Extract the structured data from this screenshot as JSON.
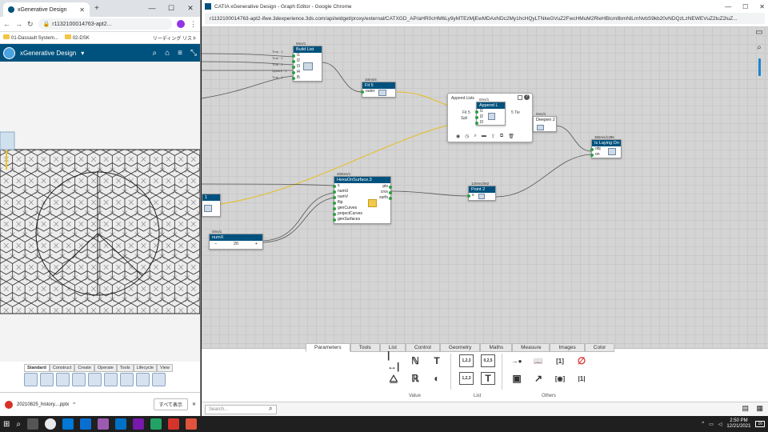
{
  "left_browser": {
    "tab_title": "xGenerative Design",
    "url": "r1132100014763-apt2...",
    "bookmarks": [
      "01-Dassault System...",
      "02-DSK",
      "リーディング リスト"
    ],
    "app_title": "xGenerative Design",
    "app_menu": "▾",
    "toolbar_tabs": [
      "Standard",
      "Construct",
      "Create",
      "Operate",
      "Tools",
      "Lifecycle",
      "View"
    ],
    "download_file": "20210825_history....pptx",
    "show_all": "すべて表示"
  },
  "right_browser": {
    "window_title": "CATIA xGenerative Design - Graph Editor - Google Chrome",
    "url": "r1132100014763-apt2-ifwe.3dexperience.3ds.com/api/widget/proxy/external/CATXGD_AP/aHR0cHM6Ly9yMTEzMjEwMDAxNDc2My1hcHQyLTNkeGVuZ2FwcHMuM2RleHBlcmllbmNlLmNvbS9kb20vNDQzLzNEWEVuZ2luZ2luZ..."
  },
  "nodes": {
    "build_list": {
      "status": "0ms/1",
      "title": "Build List",
      "ports": [
        "l1",
        "l2",
        "l3",
        "l4",
        "l5"
      ],
      "inputs": [
        "True - 1",
        "True - 1",
        "True - 1",
        "Sphere - 1",
        "True - 1"
      ]
    },
    "fit": {
      "status": "10ms/4",
      "title": "Fit 5",
      "ports": [
        "outer"
      ]
    },
    "append_lists": {
      "panel_label": "Append Lists",
      "status": "0ms/1",
      "title": "Append L",
      "ports_left": [
        "Fit 5",
        "Spli"
      ],
      "ports": [
        "l1",
        "l2",
        "l3"
      ],
      "out": "5 Tie"
    },
    "deepen": {
      "status": "0ms/1",
      "title": "Deepen 2"
    },
    "is_laying_on": {
      "status": "356ms/1396",
      "title": "Is Laying On",
      "ports": [
        "obj",
        "on"
      ]
    },
    "hexa": {
      "status": "206ms/1",
      "title": "HexaOnSurface.3",
      "ports": [
        "s",
        "numU",
        "numV",
        "flip",
        "genCurves",
        "projectCurves",
        "genSurfaces"
      ],
      "outs": [
        "pts",
        "crvs",
        "surfs"
      ]
    },
    "point": {
      "status": "120ms/392",
      "title": "Point 2",
      "ports": [
        "s"
      ]
    },
    "numx": {
      "status": "0ms/1",
      "title": "numX",
      "minus": "−",
      "value": "20",
      "plus": "+"
    },
    "left_stub": {
      "title": "1"
    }
  },
  "palette": {
    "tabs": [
      "Parameters",
      "Tools",
      "List",
      "Control",
      "Geometry",
      "Maths",
      "Measure",
      "Images",
      "Color"
    ],
    "active_tab": "Parameters",
    "groups": [
      "Value",
      "List",
      "Others"
    ],
    "value_icons": [
      "|↔|",
      "ℕ",
      "T",
      "⧋",
      "ℝ",
      "◐"
    ],
    "list_icons": [
      "1,2,3",
      "0,2,5",
      "1,2,3",
      "T"
    ],
    "other_icons": [
      "→●",
      "📖",
      "[1]",
      "∅",
      "▣",
      "↗",
      "[◉]",
      "|1|"
    ],
    "search_placeholder": "Search..."
  },
  "taskbar": {
    "time": "2:50 PM",
    "date": "12/21/2021",
    "notification_count": "16"
  }
}
